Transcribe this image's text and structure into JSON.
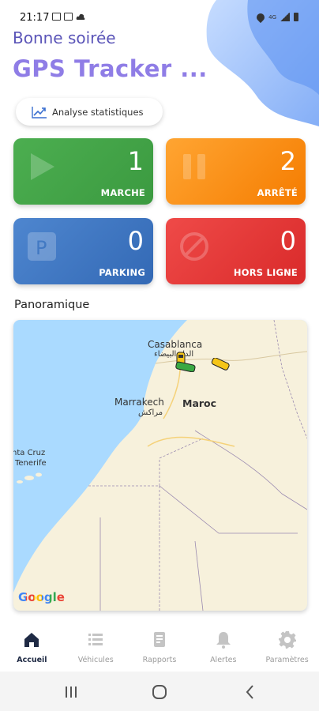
{
  "status_bar": {
    "time": "21:17",
    "right_text": "4G",
    "icons": [
      "photo-icon",
      "screen-icon",
      "cloud-icon",
      "location-icon",
      "signal-icon",
      "battery-icon"
    ]
  },
  "header": {
    "greeting": "Bonne soirée",
    "title": "GPS Tracker ..."
  },
  "stats_button": {
    "label": "Analyse statistiques",
    "icon": "trend-chart-icon"
  },
  "cards": {
    "marche": {
      "count": "1",
      "label": "MARCHE",
      "icon": "play-icon",
      "color": "#43a648"
    },
    "arrete": {
      "count": "2",
      "label": "ARRÊTÉ",
      "icon": "pause-icon",
      "color": "#f8901a"
    },
    "parking": {
      "count": "0",
      "label": "PARKING",
      "icon": "parking-icon",
      "color": "#4178c4"
    },
    "hors_ligne": {
      "count": "0",
      "label": "HORS LIGNE",
      "icon": "blocked-icon",
      "color": "#e33a39"
    }
  },
  "panorama": {
    "title": "Panoramique",
    "map": {
      "labels": {
        "casablanca_fr": "Casablanca",
        "casablanca_ar": "الدار البيضاء",
        "marrakech_fr": "Marrakech",
        "marrakech_ar": "مراكش",
        "maroc": "Maroc",
        "santa_cruz": "nta Cruz",
        "tenerife": "Tenerife"
      },
      "attribution": "Google",
      "vehicles": [
        "car-yellow-icon",
        "car-green-icon",
        "car-yellow-icon"
      ]
    }
  },
  "bottom_nav": {
    "items": [
      {
        "label": "Accueil",
        "icon": "home-icon",
        "active": true
      },
      {
        "label": "Véhicules",
        "icon": "list-icon",
        "active": false
      },
      {
        "label": "Rapports",
        "icon": "report-icon",
        "active": false
      },
      {
        "label": "Alertes",
        "icon": "bell-icon",
        "active": false
      },
      {
        "label": "Paramètres",
        "icon": "gear-icon",
        "active": false
      }
    ]
  },
  "system_nav": [
    "recents-icon",
    "home-circle-icon",
    "back-icon"
  ]
}
